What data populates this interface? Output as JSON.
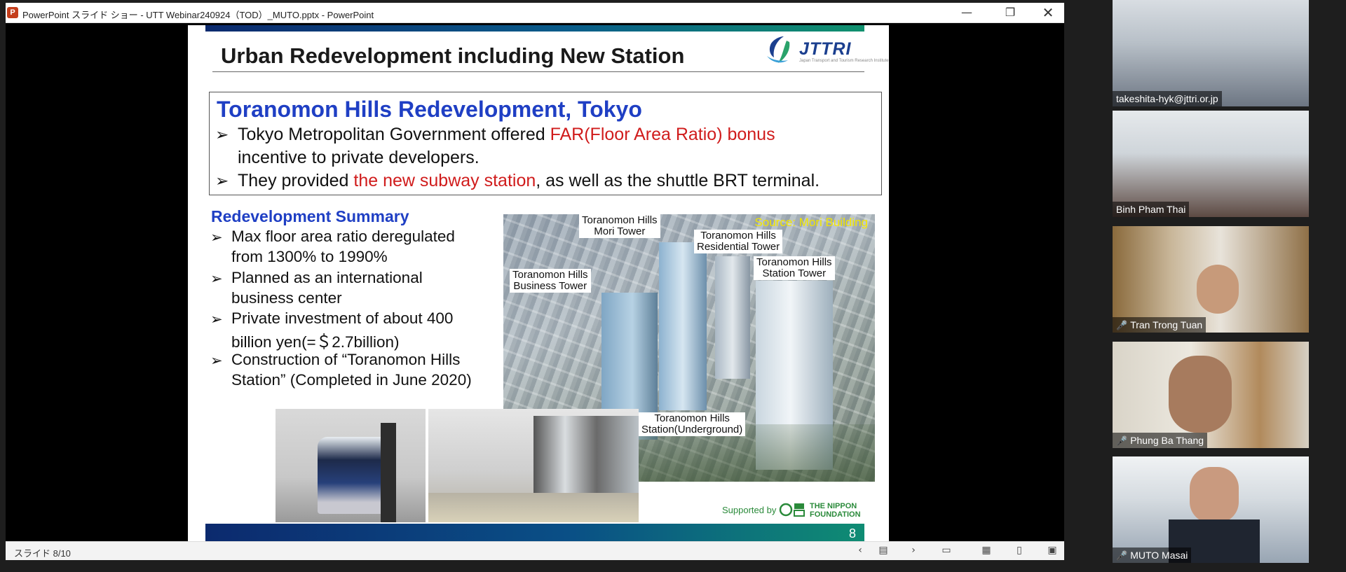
{
  "window": {
    "title": "PowerPoint スライド ショー - UTT Webinar240924（TOD）_MUTO.pptx - PowerPoint",
    "app_icon": "P"
  },
  "slide": {
    "title": "Urban Redevelopment including New Station",
    "logo_text": "JTTRI",
    "logo_subtitle": "Japan Transport and Tourism Research Institute",
    "box_heading": "Toranomon Hills Redevelopment, Tokyo",
    "bullets": [
      {
        "prefix": "Tokyo Metropolitan Government offered ",
        "highlight": "FAR(Floor Area Ratio) bonus",
        "cont": "incentive to private developers."
      },
      {
        "prefix": "They provided ",
        "highlight": "the new subway station",
        "suffix": ", as well as the shuttle BRT terminal."
      }
    ],
    "summary_heading": "Redevelopment Summary",
    "summary": [
      [
        "Max floor area ratio deregulated",
        "from 1300% to 1990%"
      ],
      [
        "Planned as an international",
        "business center"
      ],
      [
        "Private investment of about 400",
        "billion yen(=＄2.7billion)"
      ],
      [
        "Construction of “Toranomon Hills",
        "Station” (Completed in June 2020)"
      ]
    ],
    "image_labels": {
      "source": "Source: Mori Building",
      "mori_tower": [
        "Toranomon Hills",
        "Mori Tower"
      ],
      "residential_tower": [
        "Toranomon Hills",
        "Residential Tower"
      ],
      "business_tower": [
        "Toranomon Hills",
        "Business Tower"
      ],
      "station_tower": [
        "Toranomon Hills",
        "Station Tower"
      ],
      "station_underground": [
        "Toranomon Hills",
        "Station(Underground)"
      ]
    },
    "supported_by": "Supported by",
    "foundation": [
      "THE NIPPON",
      "FOUNDATION"
    ],
    "page_number": "8"
  },
  "statusbar": {
    "slide_counter": "スライド 8/10"
  },
  "participants": [
    {
      "name": "takeshita-hyk@jttri.or.jp",
      "muted": false
    },
    {
      "name": "Binh Pham Thai",
      "muted": false
    },
    {
      "name": "Tran Trong Tuan",
      "muted": true
    },
    {
      "name": "Phung Ba Thang",
      "muted": true
    },
    {
      "name": "MUTO Masai",
      "muted": true
    }
  ],
  "colors": {
    "heading_blue": "#1f3fc4",
    "highlight_red": "#d01c1c",
    "band_navy": "#0c2a6e",
    "band_green": "#10916e"
  }
}
